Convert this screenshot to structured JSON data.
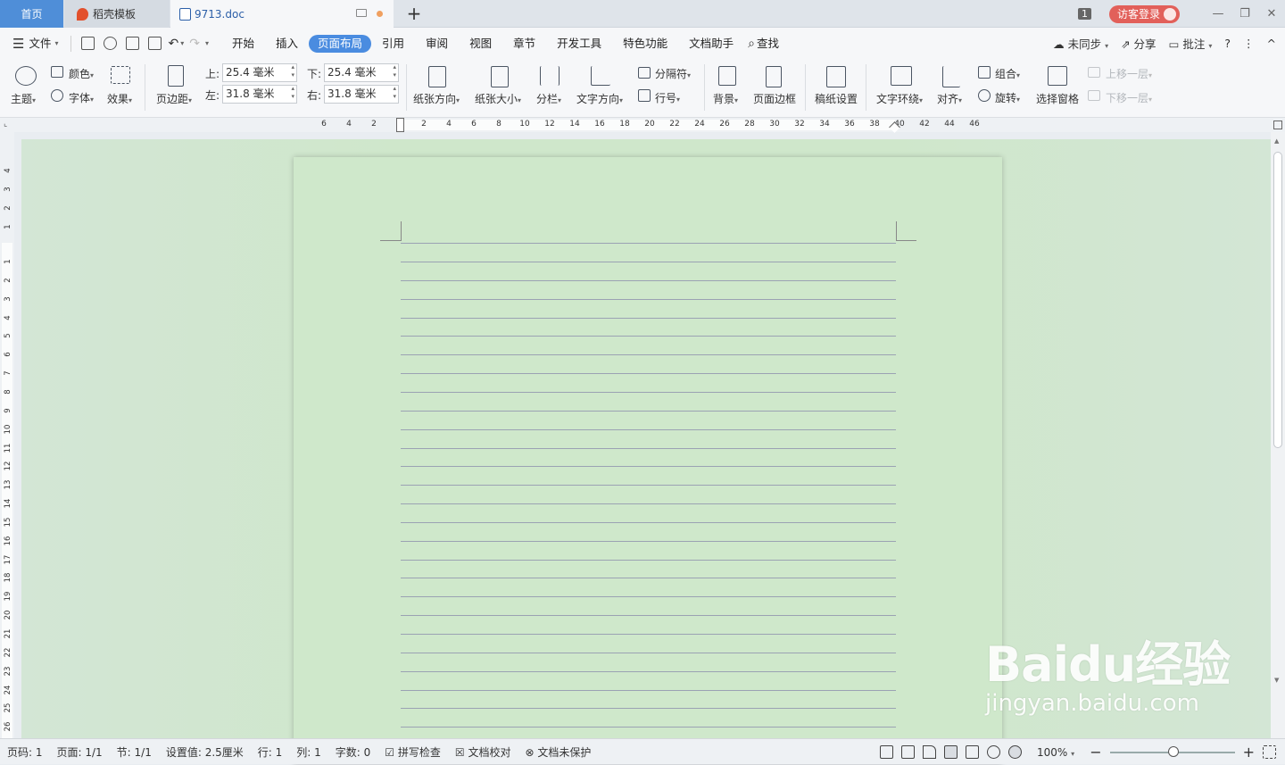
{
  "tabs": {
    "home": "首页",
    "daoke": "稻壳模板",
    "doc": "9713.doc",
    "new_tab": "+"
  },
  "window": {
    "badge": "1",
    "guest_login": "访客登录",
    "minimize": "—",
    "restore": "❐",
    "close": "✕"
  },
  "menu": {
    "file": "文件",
    "items": [
      "开始",
      "插入",
      "页面布局",
      "引用",
      "审阅",
      "视图",
      "章节",
      "开发工具",
      "特色功能",
      "文档助手"
    ],
    "active_index": 2,
    "search": "查找",
    "right": {
      "sync": "未同步",
      "share": "分享",
      "comment": "批注",
      "help": "?",
      "more": "⋮",
      "collapse": "^"
    }
  },
  "ribbon": {
    "theme": "主题",
    "color": "颜色",
    "font": "字体",
    "effect": "效果",
    "margins": "页边距",
    "top_label": "上:",
    "top_value": "25.4 毫米",
    "bottom_label": "下:",
    "bottom_value": "25.4 毫米",
    "left_label": "左:",
    "left_value": "31.8 毫米",
    "right_label": "右:",
    "right_value": "31.8 毫米",
    "orientation": "纸张方向",
    "size": "纸张大小",
    "columns": "分栏",
    "text_direction": "文字方向",
    "breaks": "分隔符",
    "line_numbers": "行号",
    "background": "背景",
    "page_border": "页面边框",
    "manuscript": "稿纸设置",
    "wrap": "文字环绕",
    "align": "对齐",
    "group": "组合",
    "rotate": "旋转",
    "selection_pane": "选择窗格",
    "bring_forward": "上移一层",
    "send_backward": "下移一层"
  },
  "ruler": {
    "h_ticks": [
      "6",
      "4",
      "2",
      "2",
      "4",
      "6",
      "8",
      "10",
      "12",
      "14",
      "16",
      "18",
      "20",
      "22",
      "24",
      "26",
      "28",
      "30",
      "32",
      "34",
      "36",
      "38",
      "40",
      "42",
      "44",
      "46"
    ],
    "v_ticks_top": [
      "4",
      "3",
      "2",
      "1"
    ],
    "v_ticks": [
      "1",
      "2",
      "3",
      "4",
      "5",
      "6",
      "7",
      "8",
      "9",
      "10",
      "11",
      "12",
      "13",
      "14",
      "15",
      "16",
      "17",
      "18",
      "19",
      "20",
      "21",
      "22",
      "23",
      "24",
      "25",
      "26"
    ]
  },
  "page": {
    "ruled_lines": 26
  },
  "status": {
    "page_num": "页码: 1",
    "pages": "页面: 1/1",
    "section": "节: 1/1",
    "setting": "设置值: 2.5厘米",
    "row": "行: 1",
    "col": "列: 1",
    "words": "字数: 0",
    "spell": "拼写检查",
    "proof": "文档校对",
    "protect": "文档未保护",
    "zoom": "100%",
    "zoom_out": "−",
    "zoom_in": "+"
  },
  "watermark": {
    "brand": "Baidu经验",
    "url": "jingyan.baidu.com"
  },
  "colors": {
    "accent": "#4a8ce0",
    "page_bg": "#cfe8cb",
    "guest_btn": "#e2605a"
  }
}
